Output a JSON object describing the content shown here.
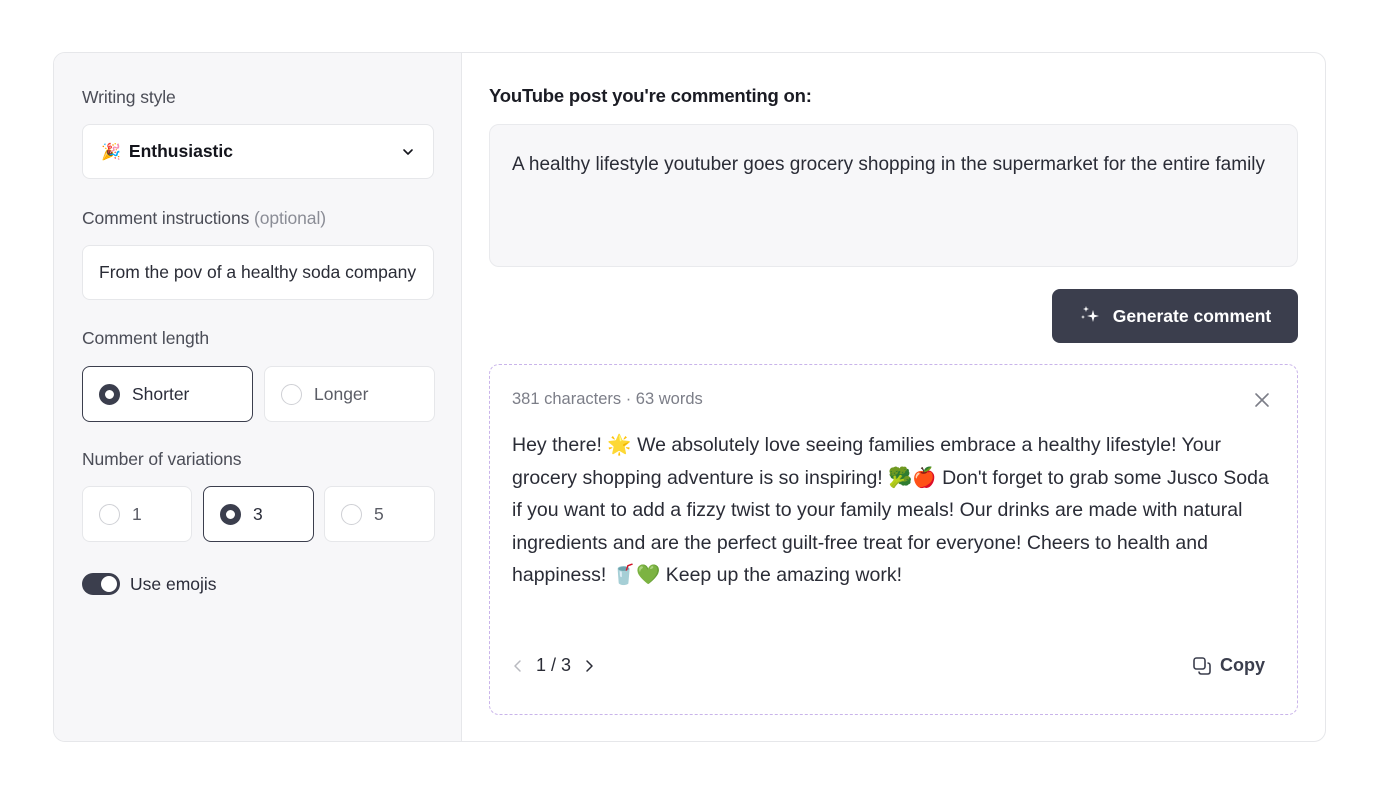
{
  "sidebar": {
    "writing_style_label": "Writing style",
    "writing_style": {
      "emoji": "🎉",
      "value": "Enthusiastic"
    },
    "instructions_label": "Comment instructions",
    "instructions_optional": "(optional)",
    "instructions_value": "From the pov of a healthy soda company",
    "length_label": "Comment length",
    "length_options": [
      {
        "label": "Shorter",
        "selected": true
      },
      {
        "label": "Longer",
        "selected": false
      }
    ],
    "variations_label": "Number of variations",
    "variation_options": [
      {
        "label": "1",
        "selected": false
      },
      {
        "label": "3",
        "selected": true
      },
      {
        "label": "5",
        "selected": false
      }
    ],
    "use_emojis_label": "Use emojis",
    "use_emojis": true
  },
  "main": {
    "post_title": "YouTube post you're commenting on:",
    "post_text": "A healthy lifestyle youtuber goes grocery shopping in the supermarket for the entire family",
    "generate_label": "Generate comment",
    "result": {
      "stats": "381 characters · 63 words",
      "comment": "Hey there! 🌟 We absolutely love seeing families embrace a healthy lifestyle! Your grocery shopping adventure is so inspiring! 🥦🍎 Don't forget to grab some Jusco Soda if you want to add a fizzy twist to your family meals! Our drinks are made with natural ingredients and are the perfect guilt-free treat for everyone! Cheers to health and happiness! 🥤💚 Keep up the amazing work!",
      "pager": "1 / 3",
      "copy_label": "Copy"
    }
  },
  "colors": {
    "accent": "#3b3e4d",
    "sidebar_bg": "#f7f7f9",
    "dashed_border": "#c9b4ea"
  }
}
